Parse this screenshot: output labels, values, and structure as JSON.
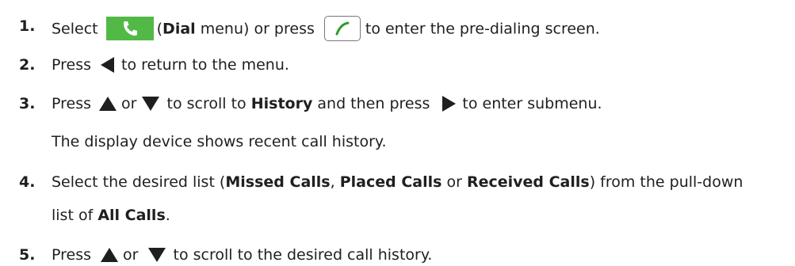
{
  "steps": [
    {
      "number": "1.",
      "t1": "Select",
      "dial_paren_open": "(",
      "dial_bold": "Dial",
      "t2": " menu) or press",
      "t3": "to enter the pre-dialing screen."
    },
    {
      "number": "2.",
      "t1": "Press",
      "t2": "to return to the menu."
    },
    {
      "number": "3.",
      "t1": "Press",
      "t2": " or ",
      "t3": "to scroll to ",
      "history_bold": "History",
      "t4": " and then press",
      "t5": "to enter submenu.",
      "note": "The display device shows recent call history."
    },
    {
      "number": "4.",
      "t1": "Select the desired list (",
      "missed_bold": "Missed Calls",
      "sep1": ", ",
      "placed_bold": "Placed Calls",
      "sep2": " or ",
      "received_bold": "Received Calls",
      "t2": ") from the pull-down",
      "t3": "list of ",
      "all_bold": "All Calls",
      "t4": "."
    },
    {
      "number": "5.",
      "t1": "Press",
      "t2": " or ",
      "t3": "to scroll to the desired call history."
    }
  ],
  "icons": {
    "dial_menu": "phone-handset-icon",
    "offhook_key": "offhook-key-icon",
    "left": "left-arrow-icon",
    "up": "up-arrow-icon",
    "down": "down-arrow-icon",
    "right": "right-arrow-icon"
  },
  "colors": {
    "dial_green": "#52b947",
    "text": "#1f1f1f"
  }
}
